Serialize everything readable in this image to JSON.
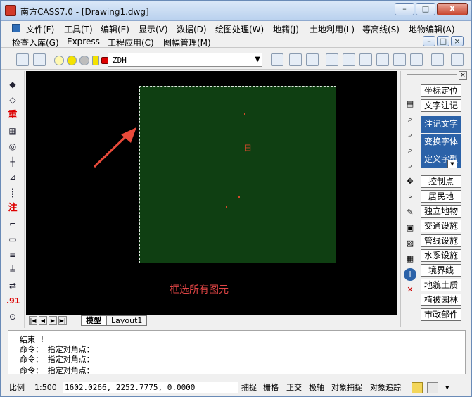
{
  "window": {
    "title": "南方CASS7.0 - [Drawing1.dwg]",
    "buttons": {
      "minimize": "–",
      "maximize": "□",
      "close": "X"
    }
  },
  "menu": {
    "row1": [
      "文件(F)",
      "工具(T)",
      "编辑(E)",
      "显示(V)",
      "数据(D)",
      "绘图处理(W)",
      "地籍(J)",
      "土地利用(L)",
      "等高线(S)",
      "地物编辑(A)"
    ],
    "row2": [
      "检查入库(G)",
      "Express",
      "工程应用(C)",
      "图幅管理(M)"
    ]
  },
  "toolbar": {
    "layer_value": "ZDH"
  },
  "left_tools": {
    "labels": [
      "重",
      "注",
      ".91"
    ]
  },
  "canvas": {
    "tip": "框选所有图元",
    "marker_text": "日",
    "colors": {
      "rect_fill": "#0f3f12",
      "dots": "#d14a2a",
      "tip": "#e04545"
    }
  },
  "tabs": {
    "items": [
      "模型",
      "Layout1"
    ]
  },
  "panel": {
    "buttons": [
      {
        "label": "坐标定位",
        "style": "normal"
      },
      {
        "label": "文字注记",
        "style": "normal"
      },
      {
        "label": "注记文字",
        "style": "blue"
      },
      {
        "label": "变换字体",
        "style": "blue"
      },
      {
        "label": "定义字型",
        "style": "blue"
      },
      {
        "label": "控制点",
        "style": "normal"
      },
      {
        "label": "居民地",
        "style": "normal"
      },
      {
        "label": "独立地物",
        "style": "normal"
      },
      {
        "label": "交通设施",
        "style": "normal"
      },
      {
        "label": "管线设施",
        "style": "normal"
      },
      {
        "label": "水系设施",
        "style": "normal"
      },
      {
        "label": "境界线",
        "style": "normal"
      },
      {
        "label": "地貌土质",
        "style": "normal"
      },
      {
        "label": "植被园林",
        "style": "normal"
      },
      {
        "label": "市政部件",
        "style": "normal"
      }
    ]
  },
  "command": {
    "lines": [
      "结束 !",
      "命令： 指定对角点：",
      "命令： 指定对角点：",
      "命令： 指定对角点："
    ]
  },
  "status": {
    "scale_label": "比例",
    "scale_value": "1:500",
    "coords": "1602.0266, 2252.7775, 0.0000",
    "toggles": [
      "捕捉",
      "栅格",
      "正交",
      "极轴",
      "对象捕捉",
      "对象追踪"
    ]
  }
}
